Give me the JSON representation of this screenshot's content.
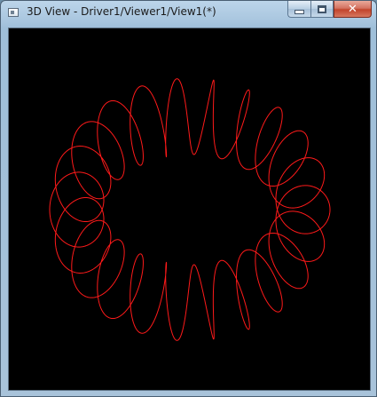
{
  "window": {
    "title": "3D View - Driver1/Viewer1/View1(*)",
    "icon": "window-icon",
    "buttons": {
      "minimize": "minimize",
      "maximize": "maximize",
      "close": "close"
    }
  },
  "viewport": {
    "background": "#000000",
    "curve_color": "#ff1a1a",
    "curve": {
      "type": "toroidal helix",
      "loops": 22
    }
  }
}
